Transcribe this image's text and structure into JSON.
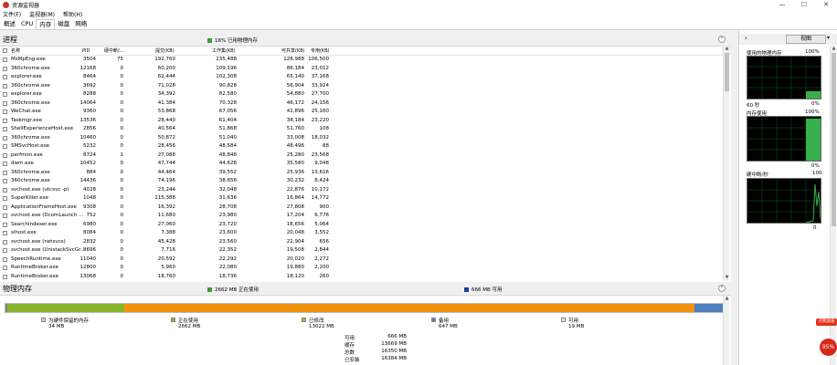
{
  "window": {
    "title": "资源监视器",
    "btn_min": "—",
    "btn_max": "☐",
    "btn_close": "✕"
  },
  "menu": [
    "文件(F)",
    "监视器(M)",
    "帮助(H)"
  ],
  "tabs": [
    "概述",
    "CPU",
    "内存",
    "磁盘",
    "网络"
  ],
  "active_tab": 2,
  "process_panel": {
    "title": "进程",
    "status": "16% 已用物理内存",
    "status_color": "#3a9d3a",
    "columns": {
      "name": "名称",
      "pid": "PID",
      "hard_faults": "硬中断/...",
      "commit": "提交(KB)",
      "working_set": "工作集(KB)",
      "shareable": "可共享(KB)",
      "private": "专用(KB)"
    },
    "rows": [
      {
        "name": "MsMpEng.exe",
        "pid": "3504",
        "hf": "75",
        "commit": "192,760",
        "ws": "235,488",
        "share": "128,988",
        "priv": "106,500"
      },
      {
        "name": "360chrome.exe",
        "pid": "12168",
        "hf": "0",
        "commit": "60,200",
        "ws": "109,196",
        "share": "86,184",
        "priv": "23,012"
      },
      {
        "name": "explorer.exe",
        "pid": "8464",
        "hf": "0",
        "commit": "62,444",
        "ws": "102,308",
        "share": "65,140",
        "priv": "37,168"
      },
      {
        "name": "360chrome.exe",
        "pid": "3692",
        "hf": "0",
        "commit": "71,028",
        "ws": "90,828",
        "share": "56,904",
        "priv": "33,924"
      },
      {
        "name": "explorer.exe",
        "pid": "8288",
        "hf": "0",
        "commit": "34,392",
        "ws": "82,580",
        "share": "54,880",
        "priv": "27,700"
      },
      {
        "name": "360chrome.exe",
        "pid": "14064",
        "hf": "0",
        "commit": "41,384",
        "ws": "70,328",
        "share": "46,172",
        "priv": "24,156"
      },
      {
        "name": "WeChat.exe",
        "pid": "9360",
        "hf": "0",
        "commit": "53,868",
        "ws": "67,056",
        "share": "41,896",
        "priv": "25,160"
      },
      {
        "name": "Taskmgr.exe",
        "pid": "13536",
        "hf": "0",
        "commit": "28,440",
        "ws": "61,404",
        "share": "38,184",
        "priv": "23,220"
      },
      {
        "name": "ShellExperienceHost.exe",
        "pid": "2856",
        "hf": "0",
        "commit": "40,564",
        "ws": "51,868",
        "share": "51,760",
        "priv": "108"
      },
      {
        "name": "360chrome.exe",
        "pid": "10460",
        "hf": "0",
        "commit": "50,872",
        "ws": "51,040",
        "share": "33,008",
        "priv": "18,032"
      },
      {
        "name": "SMSvcHost.exe",
        "pid": "5232",
        "hf": "0",
        "commit": "28,456",
        "ws": "48,584",
        "share": "48,496",
        "priv": "88"
      },
      {
        "name": "perfmon.exe",
        "pid": "8724",
        "hf": "1",
        "commit": "27,088",
        "ws": "48,848",
        "share": "25,280",
        "priv": "23,568"
      },
      {
        "name": "dwm.exe",
        "pid": "10452",
        "hf": "0",
        "commit": "47,744",
        "ws": "44,628",
        "share": "35,580",
        "priv": "9,048"
      },
      {
        "name": "360chrome.exe",
        "pid": "884",
        "hf": "0",
        "commit": "44,464",
        "ws": "39,552",
        "share": "25,936",
        "priv": "13,616"
      },
      {
        "name": "360chrome.exe",
        "pid": "14436",
        "hf": "0",
        "commit": "74,196",
        "ws": "38,656",
        "share": "30,232",
        "priv": "8,424"
      },
      {
        "name": "svchost.exe (utcsvc -p)",
        "pid": "4028",
        "hf": "0",
        "commit": "23,244",
        "ws": "32,048",
        "share": "22,876",
        "priv": "10,172"
      },
      {
        "name": "SuperKiller.exe",
        "pid": "1048",
        "hf": "0",
        "commit": "115,388",
        "ws": "31,636",
        "share": "16,864",
        "priv": "14,772"
      },
      {
        "name": "ApplicationFrameHost.exe",
        "pid": "9308",
        "hf": "0",
        "commit": "16,392",
        "ws": "28,708",
        "share": "27,808",
        "priv": "900"
      },
      {
        "name": "svchost.exe (DcomLaunch ...",
        "pid": "752",
        "hf": "0",
        "commit": "11,680",
        "ws": "23,980",
        "share": "17,204",
        "priv": "6,776"
      },
      {
        "name": "SearchIndexer.exe",
        "pid": "6980",
        "hf": "0",
        "commit": "27,060",
        "ws": "23,720",
        "share": "18,656",
        "priv": "5,064"
      },
      {
        "name": "sihost.exe",
        "pid": "8084",
        "hf": "0",
        "commit": "7,388",
        "ws": "23,600",
        "share": "20,048",
        "priv": "3,552"
      },
      {
        "name": "svchost.exe (netsvcs)",
        "pid": "2832",
        "hf": "0",
        "commit": "45,428",
        "ws": "23,560",
        "share": "22,904",
        "priv": "656"
      },
      {
        "name": "svchost.exe (UnistackSvcGr...",
        "pid": "8696",
        "hf": "0",
        "commit": "7,716",
        "ws": "22,352",
        "share": "19,508",
        "priv": "2,844"
      },
      {
        "name": "SpeechRuntime.exe",
        "pid": "11040",
        "hf": "0",
        "commit": "20,592",
        "ws": "22,292",
        "share": "20,020",
        "priv": "2,272"
      },
      {
        "name": "RuntimeBroker.exe",
        "pid": "12800",
        "hf": "0",
        "commit": "5,960",
        "ws": "22,080",
        "share": "19,880",
        "priv": "2,200"
      },
      {
        "name": "RuntimeBroker.exe",
        "pid": "13068",
        "hf": "0",
        "commit": "18,760",
        "ws": "18,736",
        "share": "18,120",
        "priv": "260"
      }
    ]
  },
  "memory_panel": {
    "title": "物理内存",
    "status_used": "2662 MB 正在使用",
    "status_avail": "666 MB 可用",
    "bar": [
      {
        "key": "reserved",
        "fraction": 0.003,
        "color": "#808080"
      },
      {
        "key": "inuse",
        "fraction": 0.162,
        "color": "#88b42c"
      },
      {
        "key": "modified",
        "fraction": 0.792,
        "color": "#f0920c"
      },
      {
        "key": "standby",
        "fraction": 0.039,
        "color": "#4e7fc0"
      },
      {
        "key": "free",
        "fraction": 0.004,
        "color": "#c8d8ec"
      }
    ],
    "legend": [
      {
        "label": "为硬件保留的内存",
        "value": "34 MB",
        "color": "#d0d0d0"
      },
      {
        "label": "正在使用",
        "value": "2662 MB",
        "color": "#88b42c"
      },
      {
        "label": "已修改",
        "value": "13022 MB",
        "color": "#f0920c"
      },
      {
        "label": "备用",
        "value": "647 MB",
        "color": "#4e7fc0"
      },
      {
        "label": "可用",
        "value": "19 MB",
        "color": "#d8e4f4"
      }
    ],
    "stats": [
      {
        "label": "可用",
        "value": "666 MB"
      },
      {
        "label": "缓存",
        "value": "13669 MB"
      },
      {
        "label": "总数",
        "value": "16350 MB"
      },
      {
        "label": "已安装",
        "value": "16384 MB"
      }
    ]
  },
  "right_panel": {
    "view_label": "视图",
    "graphs": [
      {
        "title": "使用的物理内存",
        "max": "100%",
        "time": "60 秒",
        "min": "0%"
      },
      {
        "title": "内存使用",
        "max": "100%",
        "min": "0%"
      },
      {
        "title": "硬中断/秒",
        "max": "100",
        "min": "0"
      }
    ]
  },
  "sticker": {
    "line1": "点我加速",
    "line2": "95%"
  }
}
